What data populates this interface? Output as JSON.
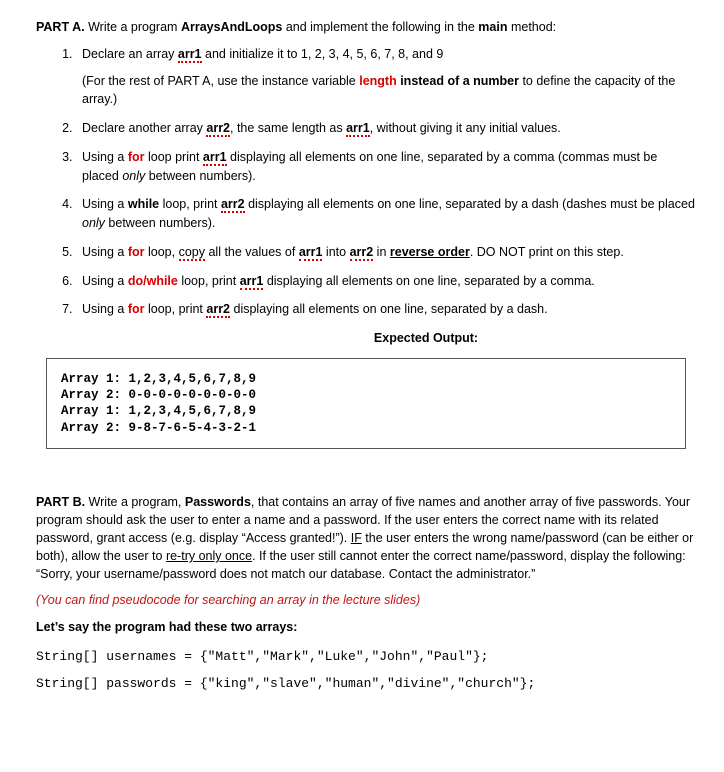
{
  "partA": {
    "heading_prefix": "PART A.",
    "heading_rest": " Write a program ",
    "heading_prog": "ArraysAndLoops",
    "heading_rest2": " and implement the following in the ",
    "heading_main": "main",
    "heading_rest3": " method:",
    "items": [
      {
        "pre": "Declare an array ",
        "var": "arr1",
        "post": " and initialize it to 1, 2, 3, 4, 5, 6, 7, 8, and 9",
        "sub_pre": "(For the rest of PART A, use the instance variable ",
        "sub_len": "length",
        "sub_mid": " instead of a number",
        "sub_post": " to define the capacity of the array.)"
      },
      {
        "pre": "Declare another array ",
        "var": "arr2",
        "mid": ", the same length as ",
        "var2": "arr1",
        "post": ", without giving it any initial values."
      },
      {
        "pre": "Using a ",
        "kw": "for",
        "mid": " loop print ",
        "var": "arr1",
        "post": " displaying all elements on one line, separated by a comma (commas must be placed ",
        "only": "only",
        "post2": " between numbers)."
      },
      {
        "pre": "Using a ",
        "kw": "while",
        "mid": " loop, print ",
        "var": "arr2",
        "post": " displaying all elements on one line, separated by a dash (dashes must be placed ",
        "only": "only",
        "post2": " between numbers)."
      },
      {
        "pre": "Using a ",
        "kw": "for",
        "mid": " loop, ",
        "copy": "copy",
        "mid2": " all the values of ",
        "var": "arr1",
        "mid3": " into ",
        "var2": "arr2",
        "mid4": " in ",
        "rev": "reverse order",
        "post": ". DO NOT print on this step."
      },
      {
        "pre": "Using a ",
        "kw": "do/while",
        "mid": " loop, print ",
        "var": "arr1",
        "post": " displaying all elements on one line, separated by a comma."
      },
      {
        "pre": "Using a ",
        "kw": "for",
        "mid": " loop, print ",
        "var": "arr2",
        "post": " displaying all elements on one line, separated by a dash."
      }
    ],
    "expected_label": "Expected Output:",
    "output_lines": [
      "Array 1: 1,2,3,4,5,6,7,8,9",
      "Array 2: 0-0-0-0-0-0-0-0-0",
      "Array 1: 1,2,3,4,5,6,7,8,9",
      "Array 2: 9-8-7-6-5-4-3-2-1"
    ]
  },
  "partB": {
    "heading_prefix": "PART B.",
    "heading_rest1": " Write a program, ",
    "heading_prog": "Passwords",
    "heading_rest2": ", that contains an array of five names and another array of five passwords. Your program should ask the user to enter a name and a password. If the user enters the correct name with its related password, grant access (e.g. display “Access granted!”). ",
    "if_word": "IF",
    "heading_rest3": " the user enters the wrong name/password (can be either or both), allow the user to ",
    "retry": "re-try only once",
    "heading_rest4": ". If the user still cannot enter the correct name/password, display the following: “Sorry, your username/password does not match our database. Contact the administrator.”",
    "pseudo": "(You can find pseudocode for searching an array in the lecture slides)",
    "arrays_title": "Let’s say the program had these two arrays:",
    "code1": "String[] usernames = {\"Matt\",\"Mark\",\"Luke\",\"John\",\"Paul\"};",
    "code2": "String[] passwords = {\"king\",\"slave\",\"human\",\"divine\",\"church\"};"
  }
}
